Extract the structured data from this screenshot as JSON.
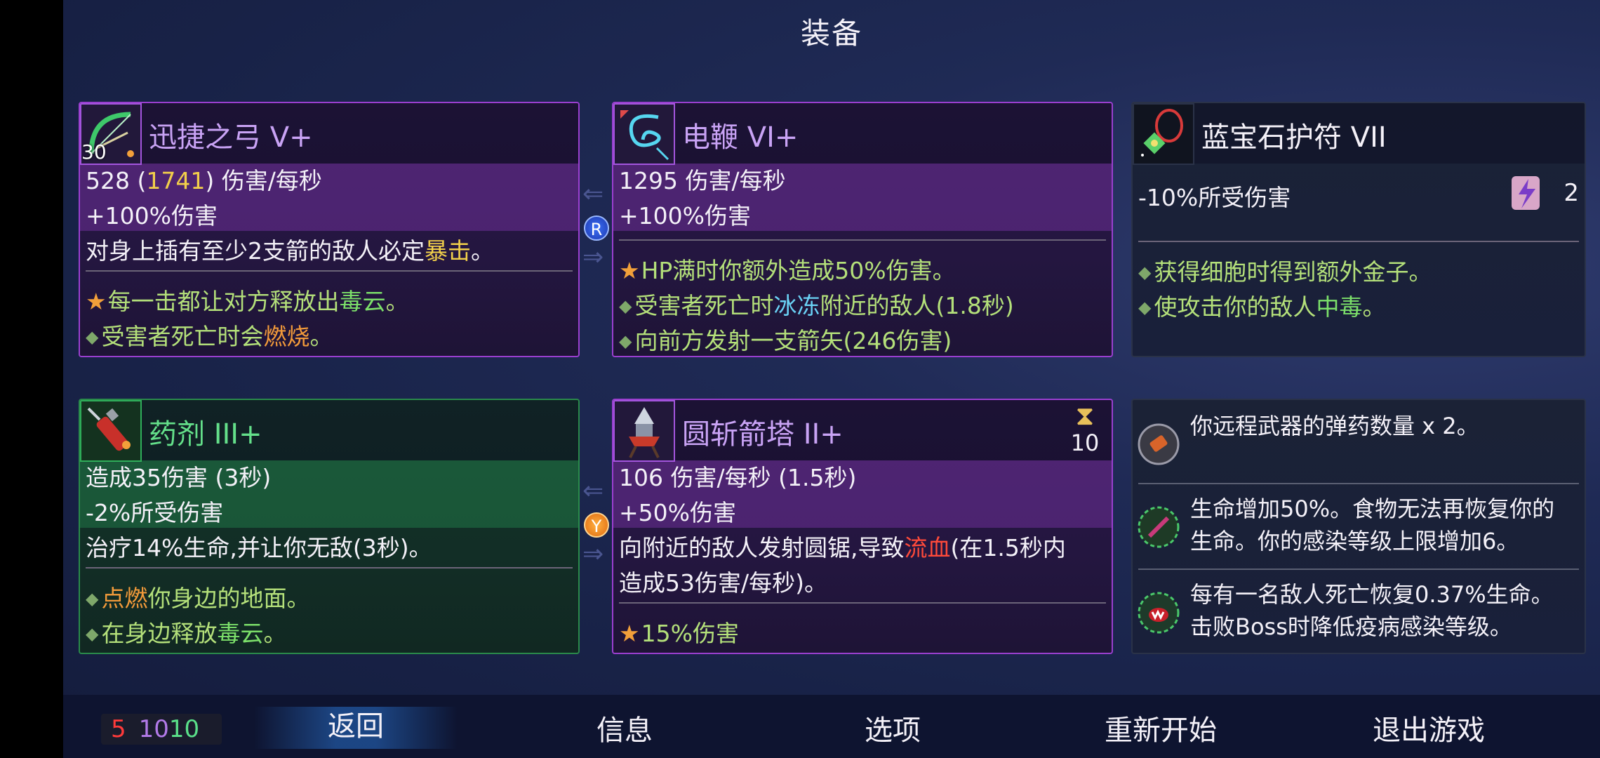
{
  "title": "装备",
  "cards": {
    "bow": {
      "name": "迅捷之弓  V+",
      "level": "30",
      "dps_base": "528",
      "dps_extra": "1741",
      "dps_unit": "伤害/每秒",
      "bonus": "+100%伤害",
      "desc_pre": "对身上插有至少2支箭的敌人必定",
      "desc_hl": "暴击",
      "desc_post": "。",
      "e1_pre": "每一击都让对方释放出",
      "e1_hl": "毒云",
      "e1_post": "。",
      "e2_pre": "受害者死亡时会",
      "e2_hl": "燃烧",
      "e2_post": "。"
    },
    "whip": {
      "name": "电鞭  VI+",
      "dps": "1295  伤害/每秒",
      "bonus": "+100%伤害",
      "e1": "HP满时你额外造成50%伤害。",
      "e2_pre": "受害者死亡时",
      "e2_hl": "冰冻",
      "e2_post": "附近的敌人(1.8秒)",
      "e3": "向前方发射一支箭矢(246伤害)"
    },
    "amulet": {
      "name": "蓝宝石护符  VII",
      "stat": "-10%所受伤害",
      "scroll_count": "2",
      "e1_pre": "获得细胞时得到额外",
      "e1_hl": "金子",
      "e1_post": "。",
      "e2_pre": "使攻击你的敌人",
      "e2_hl": "中毒",
      "e2_post": "。"
    },
    "potion": {
      "name": "药剂  III+",
      "l1": "造成35伤害  (3秒)",
      "l2": "-2%所受伤害",
      "l3": "治疗14%生命,并让你无敌(3秒)。",
      "e1_hl": "点燃",
      "e1_post": "你身边的地面。",
      "e2_pre": "在身边释放",
      "e2_hl": "毒云",
      "e2_post": "。"
    },
    "turret": {
      "name": "圆斩箭塔  II+",
      "timer": "10",
      "l1": "106  伤害/每秒  (1.5秒)",
      "l2": "+50%伤害",
      "l3_pre": "向附近的敌人发射圆锯,导致",
      "l3_hl": "流血",
      "l3_post": "(在1.5秒内",
      "l4": "造成53伤害/每秒)。",
      "e1": "15%伤害"
    }
  },
  "connectors": {
    "top_badge": "R",
    "bottom_badge": "Y"
  },
  "mutations": [
    {
      "text": "你远程武器的弹药数量  x  2。"
    },
    {
      "text1": "生命增加50%。食物无法再恢复你的",
      "text2": "生命。你的感染等级上限增加6。"
    },
    {
      "text1": "每有一名敌人死亡恢复0.37%生命。",
      "text2": "击败Boss时降低疫病感染等级。"
    }
  ],
  "scrolls": {
    "red": "5",
    "purple": "10",
    "green": "10"
  },
  "menu": {
    "back": "返回",
    "info": "信息",
    "options": "选项",
    "restart": "重新开始",
    "quit": "退出游戏"
  },
  "colors": {
    "brutality": "#9a3fcf",
    "survival": "#2a8a4a",
    "highlight_gold": "#f2cf4a",
    "bleed": "#ff4a3a"
  }
}
